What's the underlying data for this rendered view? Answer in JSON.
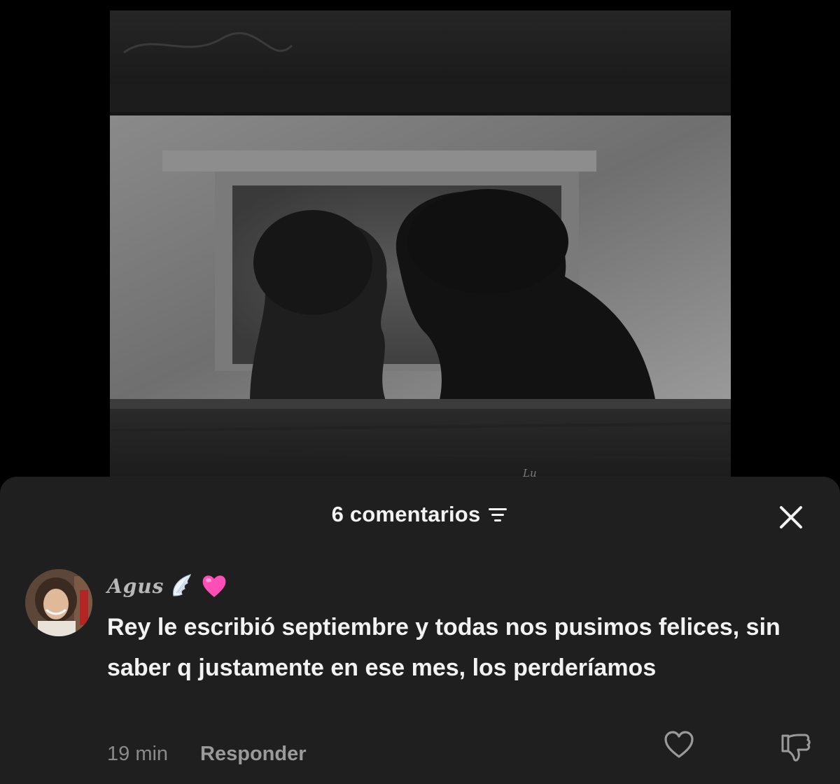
{
  "media": {
    "watermark": "Lu"
  },
  "comments_sheet": {
    "title": "6 comentarios",
    "sort_icon": "sort-lines-icon",
    "close_icon": "close-icon"
  },
  "comment": {
    "username": "Agus",
    "username_emojis": [
      "wing-emoji",
      "pink-heart-emoji"
    ],
    "text": "Rey le escribió septiembre y todas nos pusimos felices, sin saber q justamente en ese mes, los perderíamos",
    "time": "19 min",
    "reply_label": "Responder",
    "like_icon": "heart-outline-icon",
    "dislike_icon": "thumbs-down-icon"
  },
  "colors": {
    "sheet_background": "#1f1f1f",
    "primary_text": "#f2f2f2",
    "secondary_text": "#8a8a8a",
    "heart_emoji": "#ff4fb6"
  }
}
